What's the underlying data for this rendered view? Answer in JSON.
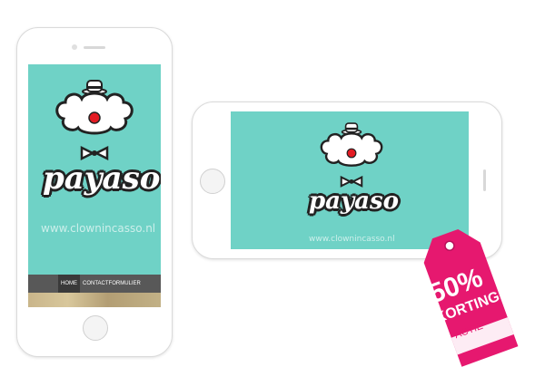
{
  "brand": {
    "name": "payaso",
    "url": "www.clownincasso.nl"
  },
  "nav": {
    "items": [
      {
        "label": "HOME"
      },
      {
        "label": "CONTACTFORMULIER"
      }
    ]
  },
  "tag": {
    "discount": "50%",
    "word": "KORTING",
    "sub": "ACTIE",
    "color": "#e6186f"
  },
  "colors": {
    "screen": "#6fd2c6",
    "nav": "#585858",
    "nav_active": "#3a3a3a"
  }
}
